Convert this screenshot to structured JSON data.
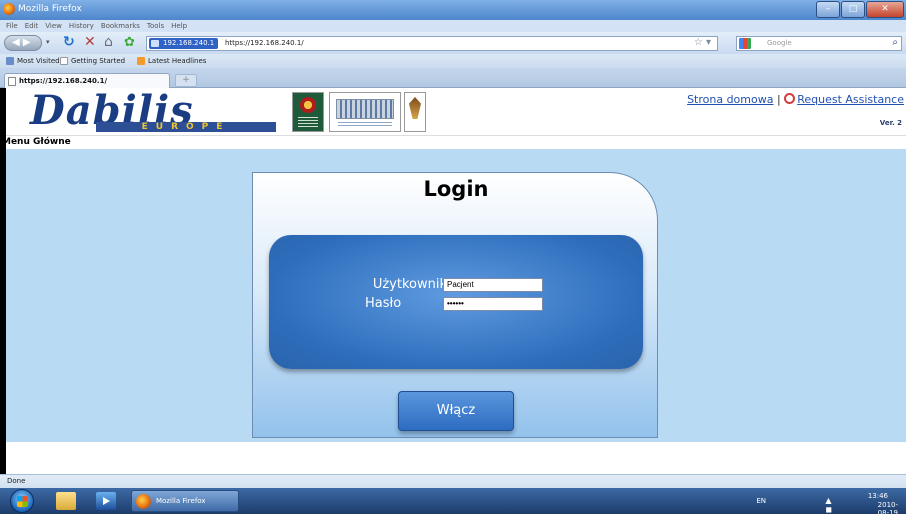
{
  "window": {
    "title": "Mozilla Firefox",
    "buttons": {
      "minimize": "–",
      "maximize": "□",
      "close": "✕"
    }
  },
  "menubar": [
    "File",
    "Edit",
    "View",
    "History",
    "Bookmarks",
    "Tools",
    "Help"
  ],
  "navbar": {
    "site_badge": "192.168.240.1",
    "url": "https://192.168.240.1/",
    "search_placeholder": "Google",
    "icons": [
      "back-icon",
      "reload-icon",
      "stop-icon",
      "home-icon",
      "addon-icon",
      "bookmark-star-icon",
      "search-icon"
    ]
  },
  "bookmarks": [
    {
      "label": "Most Visited",
      "icon": "most-visited-icon"
    },
    {
      "label": "Getting Started",
      "icon": "page-icon"
    },
    {
      "label": "Latest Headlines",
      "icon": "rss-icon"
    }
  ],
  "tabs": [
    {
      "label": "https://192.168.240.1/",
      "active": true
    }
  ],
  "new_tab_label": "+",
  "page": {
    "logo_text": "Dabilis",
    "logo_band": "EUROPE",
    "header_links": {
      "home": "Strona domowa",
      "separator": "|",
      "assistance": "Request Assistance"
    },
    "version": "Ver. 2",
    "menu_title": "Menu Główne",
    "login": {
      "title": "Login",
      "username_label": "Użytkownik",
      "username_value": "Pacjent",
      "password_label": "Hasło",
      "password_value": "••••••",
      "submit_label": "Włącz"
    }
  },
  "status": "Done",
  "taskbar": {
    "task_label": "Mozilla Firefox",
    "lang": "EN",
    "tray_icons": "▲ ◼ ◢ ◀",
    "time": "13:46",
    "date": "2010-08-19"
  },
  "colors": {
    "page_background": "#b9daf3",
    "form_blue": "#2d6dbc",
    "link_blue": "#2051b0",
    "logo_navy": "#1a3c82"
  }
}
